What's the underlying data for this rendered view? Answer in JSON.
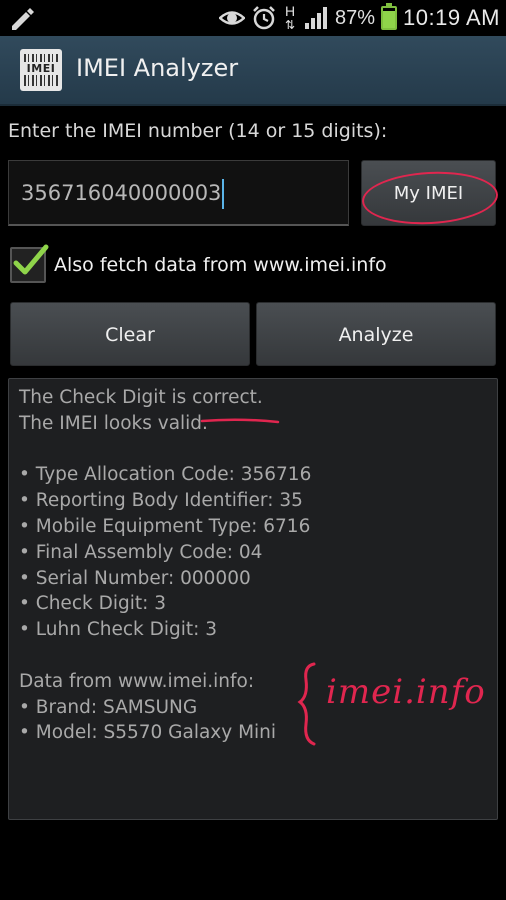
{
  "status_bar": {
    "battery_percent": "87%",
    "battery_level": 0.87,
    "time": "10:19 AM",
    "icons": [
      "pencil-icon",
      "eye-icon",
      "alarm-icon",
      "hspa-data-icon",
      "signal-icon",
      "battery-icon"
    ],
    "network_label": "H"
  },
  "action_bar": {
    "title": "IMEI Analyzer",
    "icon_text": "IMEI"
  },
  "form": {
    "prompt": "Enter the IMEI number (14 or 15 digits):",
    "imei_value": "356716040000003",
    "my_imei_label": "My IMEI",
    "fetch_checkbox_label": "Also fetch data from www.imei.info",
    "fetch_checked": true,
    "clear_label": "Clear",
    "analyze_label": "Analyze"
  },
  "results": {
    "check_digit_prefix": "The Check Digit is ",
    "check_digit_status": "correct.",
    "validity": "The IMEI looks valid.",
    "fields": [
      "• Type Allocation Code: 356716",
      "• Reporting Body Identifier: 35",
      "• Mobile Equipment Type: 6716",
      "• Final Assembly Code: 04",
      "• Serial Number: 000000",
      "• Check Digit: 3",
      "• Luhn Check Digit: 3"
    ],
    "external_header": "Data from www.imei.info:",
    "external_fields": [
      "• Brand: SAMSUNG",
      "• Model: S5570 Galaxy Mini"
    ]
  },
  "annotations": {
    "handwritten_note": "imei.info",
    "annotation_color": "#e0264f"
  },
  "colors": {
    "action_bar": "#2c4354",
    "checkmark": "#8fd44a",
    "caret": "#5ab4e8"
  }
}
